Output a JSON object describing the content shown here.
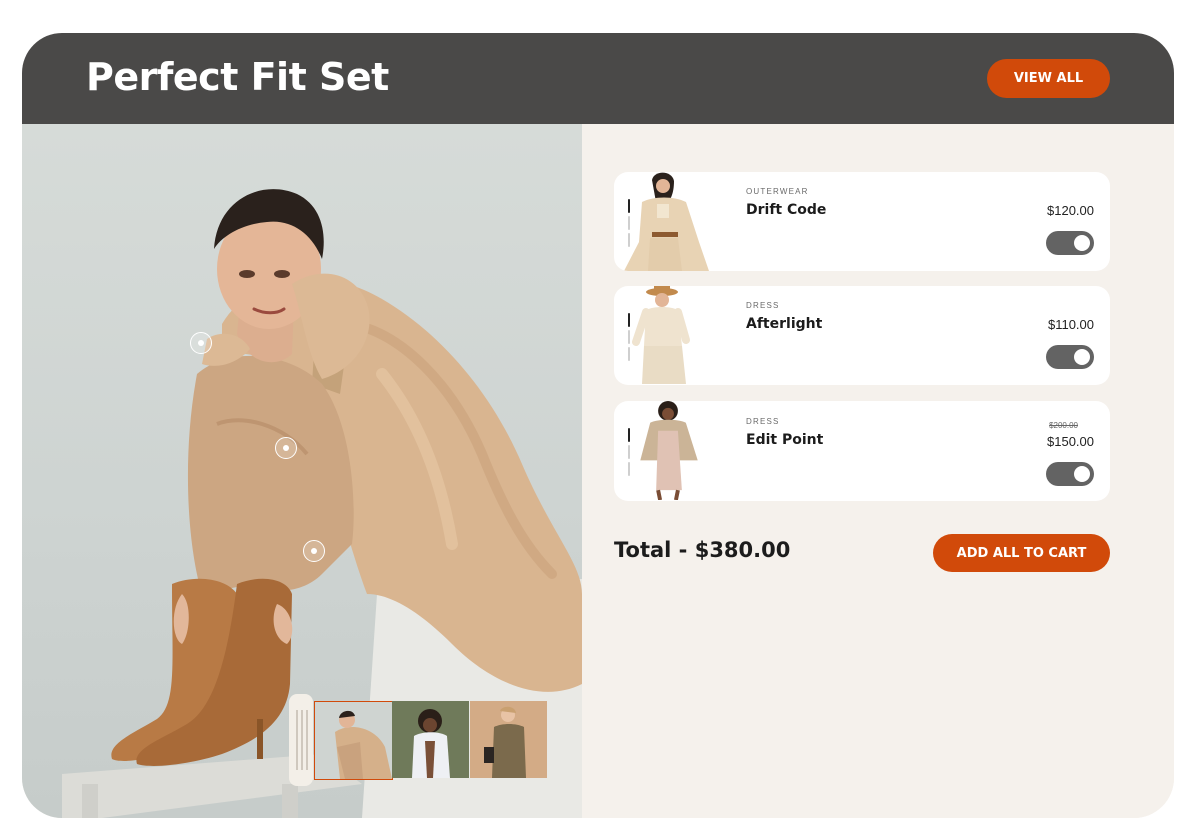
{
  "header": {
    "title": "Perfect Fit Set",
    "view_all_label": "VIEW ALL"
  },
  "colors": {
    "accent": "#d14a0a",
    "header_bg": "#4a4948",
    "panel_bg": "#f5f1ec"
  },
  "products": [
    {
      "category": "OUTERWEAR",
      "name": "Drift Code",
      "price": "$120.00",
      "selected": true
    },
    {
      "category": "DRESS",
      "name": "Afterlight",
      "price": "$110.00",
      "selected": true
    },
    {
      "category": "DRESS",
      "name": "Edit Point",
      "old_price": "$200.00",
      "price": "$150.00",
      "selected": true
    }
  ],
  "summary": {
    "total": "Total - $380.00",
    "add_all_label": "ADD ALL TO CART"
  },
  "gallery": {
    "thumbnail_count": 3,
    "active_index": 0
  }
}
